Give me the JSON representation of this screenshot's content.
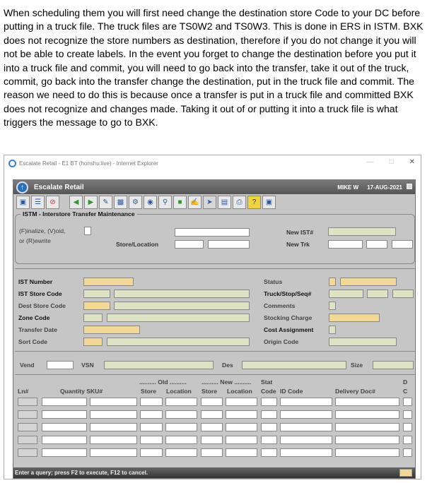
{
  "document": {
    "paragraph": "When scheduling them you will first need change the destination store Code to your DC before putting in a truck file.  The truck files are TS0W2 and TS0W3.  This is done in ERS in ISTM.   BXK does not recognize the store numbers as destination, therefore if you do not change it you will not be able to create labels.  In the event you forget to change the destination before you put it into a truck file and commit, you will need to go back into the transfer, take it out of the truck, commit, go back into the transfer change the destination, put in the truck file and commit.  The reason we need to do this is because once a transfer is put in a truck file and committed BXK does not recognize and changes made.  Taking it out of or putting it into a truck file is what triggers the message to go to BXK."
  },
  "window": {
    "title": "Escalate Retail - E1 BT (honshu:live) - Internet Explorer"
  },
  "app": {
    "name": "Escalate Retail",
    "user": "MIKE W",
    "date": "17-AUG-2021",
    "toolbar_icons": [
      "window-icon",
      "list-icon",
      "cancel-icon",
      "back-icon",
      "forward-icon",
      "record-icon",
      "edit-icon",
      "gear-icon",
      "binoculars-icon",
      "search-icon",
      "save-icon",
      "notes-icon",
      "pointer-icon",
      "print-preview-icon",
      "print-icon",
      "help-icon",
      "exit-icon"
    ],
    "section_title": "ISTM - Interstore Transfer Maintenance",
    "fields": {
      "finalize_label": "(F)inalize, (V)oid,",
      "rewrite_label": "or (R)ewrite",
      "store_location": "Store/Location",
      "new_ist": "New IST#",
      "new_trk": "New Trk",
      "ist_number": "IST Number",
      "ist_store_code": "IST Store Code",
      "dest_store_code": "Dest Store Code",
      "zone_code": "Zone Code",
      "transfer_date": "Transfer Date",
      "sort_code": "Sort Code",
      "status": "Status",
      "truck_stop_seq": "Truck/Stop/Seq#",
      "comments": "Comments",
      "stocking_charge": "Stocking Charge",
      "cost_assignment": "Cost Assignment",
      "origin_code": "Origin Code",
      "vend": "Vend",
      "vsn": "VSN",
      "des": "Des",
      "size": "Size"
    },
    "grid": {
      "group_old": "Old",
      "group_new": "New",
      "group_stat": "Stat",
      "d_label": "D",
      "c_label": "C",
      "headers": [
        "Ln#",
        "Quantity SKU#",
        "Store",
        "Location",
        "Store",
        "Location",
        "Code",
        "ID Code",
        "Delivery Doc#"
      ]
    },
    "status_message": "Enter a query; press F2 to execute, F12 to cancel."
  }
}
